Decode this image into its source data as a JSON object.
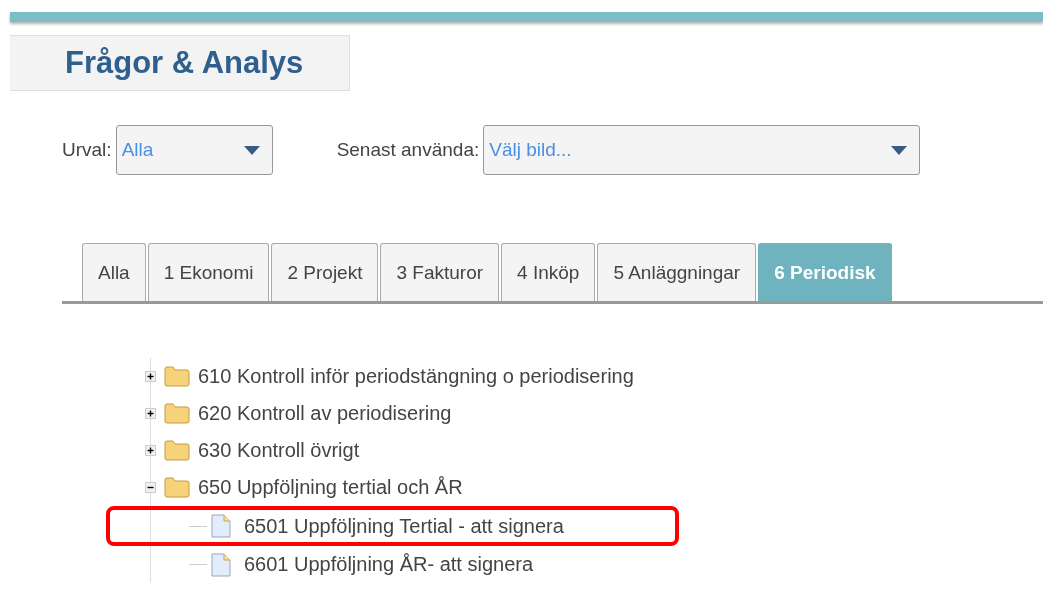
{
  "title": "Frågor & Analys",
  "filters": [
    {
      "label": "Urval:",
      "value": "Alla"
    },
    {
      "label": "Senast använda:",
      "placeholder": "Välj bild..."
    }
  ],
  "tabs": [
    {
      "label": "Alla",
      "selected": false
    },
    {
      "label": "1 Ekonomi",
      "selected": false
    },
    {
      "label": "2 Projekt",
      "selected": false
    },
    {
      "label": "3 Fakturor",
      "selected": false
    },
    {
      "label": "4 Inköp",
      "selected": false
    },
    {
      "label": "5 Anläggningar",
      "selected": false
    },
    {
      "label": "6 Periodisk",
      "selected": true
    }
  ],
  "tree": [
    {
      "label": "610 Kontroll inför periodstängning o periodisering",
      "expanded": false
    },
    {
      "label": "620 Kontroll av periodisering",
      "expanded": false
    },
    {
      "label": "630 Kontroll övrigt",
      "expanded": false
    },
    {
      "label": "650 Uppföljning tertial och ÅR",
      "expanded": true,
      "children": [
        {
          "label": "6501 Uppföljning Tertial - att signera",
          "highlighted": true
        },
        {
          "label": "6601 Uppföljning ÅR- att signera",
          "highlighted": false
        }
      ]
    }
  ]
}
